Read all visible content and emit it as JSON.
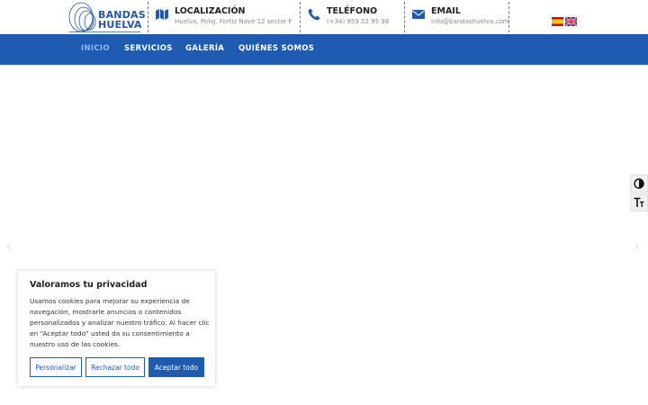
{
  "header": {
    "logo_text_line1": "BANDAS",
    "logo_text_line2": "HUELVA",
    "location": {
      "title": "LOCALIZACIÓN",
      "value": "Huelva, Polig. Fortiz Nave 12 sector F",
      "icon": "map-icon"
    },
    "phone": {
      "title": "TELÉFONO",
      "value": "(+34) 959 22 95 98",
      "icon": "phone-icon"
    },
    "email": {
      "title": "EMAIL",
      "value": "info@bandashuelva.com",
      "icon": "envelope-icon"
    },
    "languages": [
      "es",
      "en"
    ]
  },
  "nav": {
    "items": [
      {
        "label": "INICIO",
        "active": true
      },
      {
        "label": "SERVICIOS",
        "active": false
      },
      {
        "label": "GALERÍA",
        "active": false
      },
      {
        "label": "QUIÉNES SOMOS",
        "active": false
      }
    ]
  },
  "slider": {
    "prev_icon": "chevron-left-icon",
    "next_icon": "chevron-right-icon"
  },
  "accessibility": {
    "contrast_icon": "contrast-icon",
    "font_size_icon": "text-size-icon"
  },
  "cookie_banner": {
    "title": "Valoramos tu privacidad",
    "text": "Usamos cookies para mejorar su experiencia de navegación, mostrarle anuncios o contenidos personalizados y analizar nuestro tráfico. Al hacer clic en “Aceptar todo” usted da su consentimiento a nuestro uso de las cookies.",
    "buttons": {
      "customize": "Personalizar",
      "reject": "Rechazar todo",
      "accept": "Aceptar todo"
    }
  },
  "colors": {
    "brand": "#1e5aaf",
    "active_nav": "#8fb8ec"
  }
}
